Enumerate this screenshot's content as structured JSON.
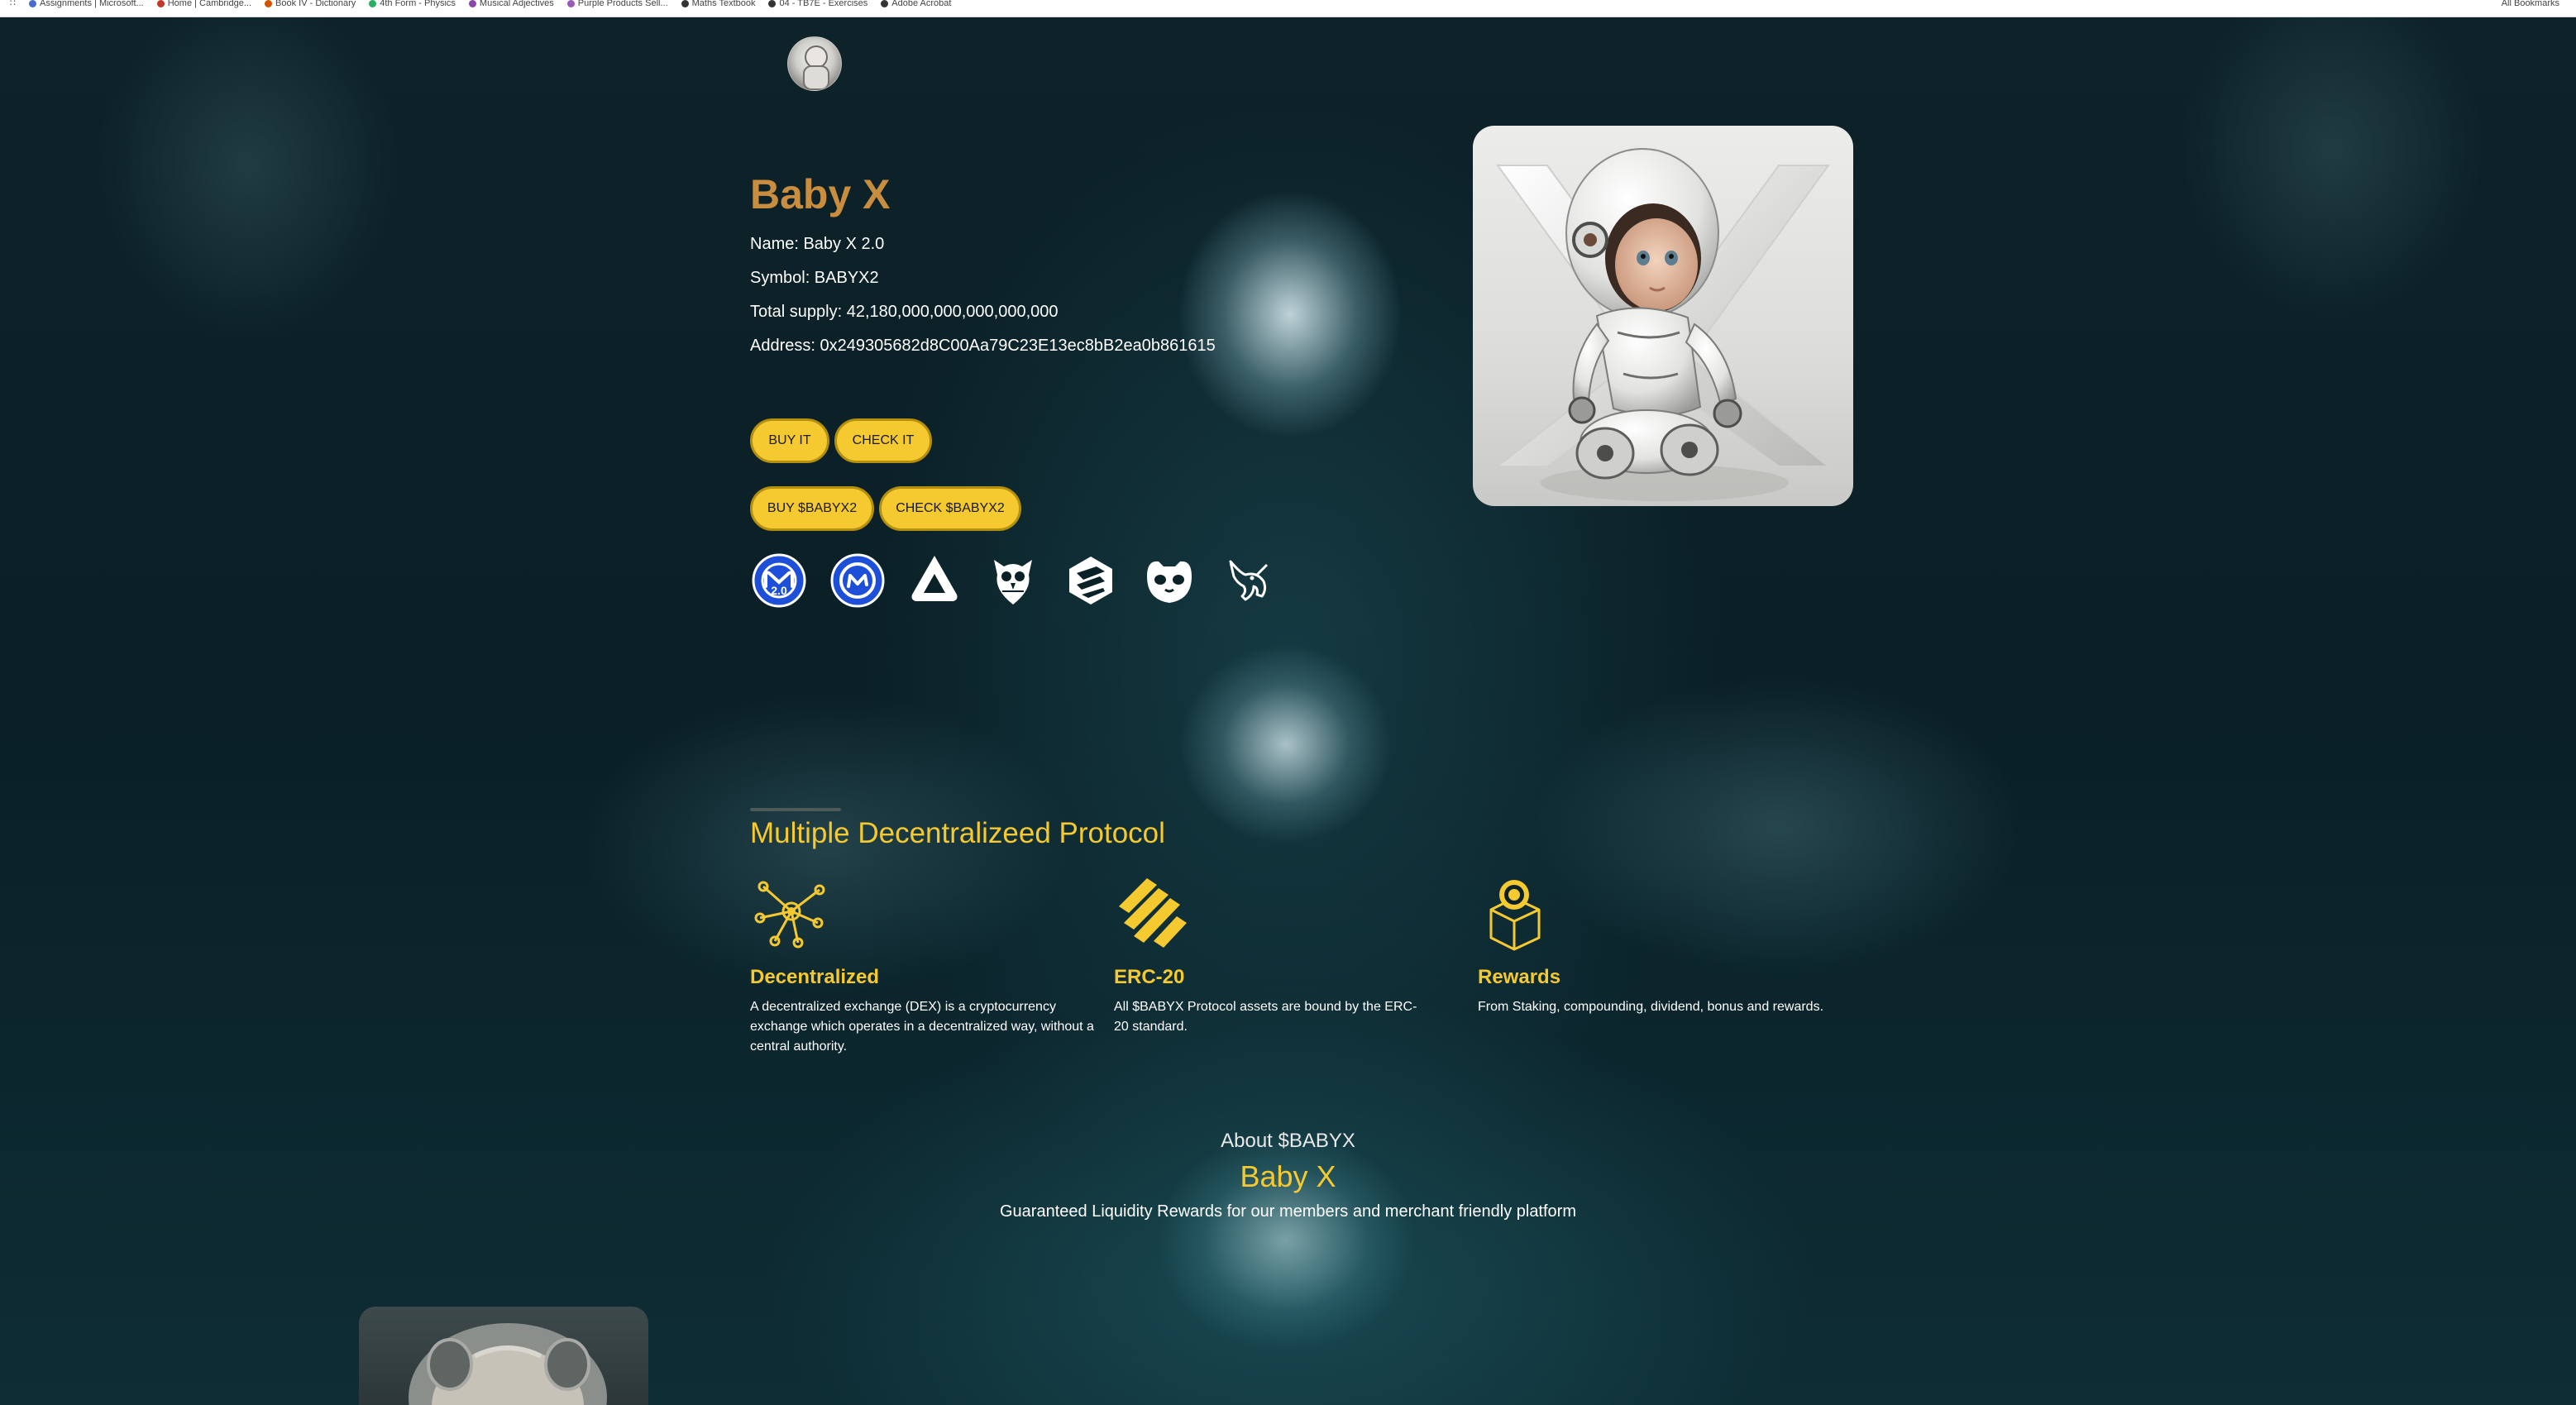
{
  "browser": {
    "bookmarks": [
      "Assignments | Microsoft...",
      "Home | Cambridge...",
      "Book IV - Dictionary",
      "4th Form - Physics",
      "Musical Adjectives",
      "Purple Products Sell...",
      "Maths Textbook",
      "04 - TB7E - Exercises",
      "Adobe Acrobat"
    ],
    "right_label": "All Bookmarks"
  },
  "token": {
    "title": "Baby X",
    "name": "Name: Baby X 2.0",
    "symbol": "Symbol: BABYX2",
    "supply": "Total supply: 42,180,000,000,000,000,000",
    "address": "Address: 0x249305682d8C00Aa79C23E13ec8bB2ea0b861615"
  },
  "buttons": {
    "buy_it": "BUY IT",
    "check_it": "CHECK IT",
    "buy_babyx2": "BUY $BABYX2",
    "check_babyx2": "CHECK $BABYX2"
  },
  "social_icons": [
    "coinmarketcap-2-icon",
    "coinmarketcap-icon",
    "arbitrum-icon",
    "owl-icon",
    "dextools-icon",
    "cat-mask-icon",
    "uniswap-unicorn-icon"
  ],
  "protocol": {
    "heading": "Multiple Decentralizeed Protocol",
    "features": [
      {
        "icon": "network-nodes-icon",
        "title": "Decentralized",
        "desc": "A decentralized exchange (DEX) is a cryptocurrency exchange which operates in a decentralized way, without a central authority."
      },
      {
        "icon": "binance-stripes-icon",
        "title": "ERC-20",
        "desc": "All $BABYX Protocol assets are bound by the ERC-20 standard."
      },
      {
        "icon": "reward-box-icon",
        "title": "Rewards",
        "desc": "From Staking, compounding, dividend, bonus and rewards."
      }
    ]
  },
  "about": {
    "label": "About $BABYX",
    "title": "Baby X",
    "subtitle": "Guaranteed Liquidity Rewards for our members and merchant friendly platform"
  },
  "colors": {
    "accent": "#f5c930",
    "title_gold": "#c88d3e",
    "background": "#0b2128"
  }
}
